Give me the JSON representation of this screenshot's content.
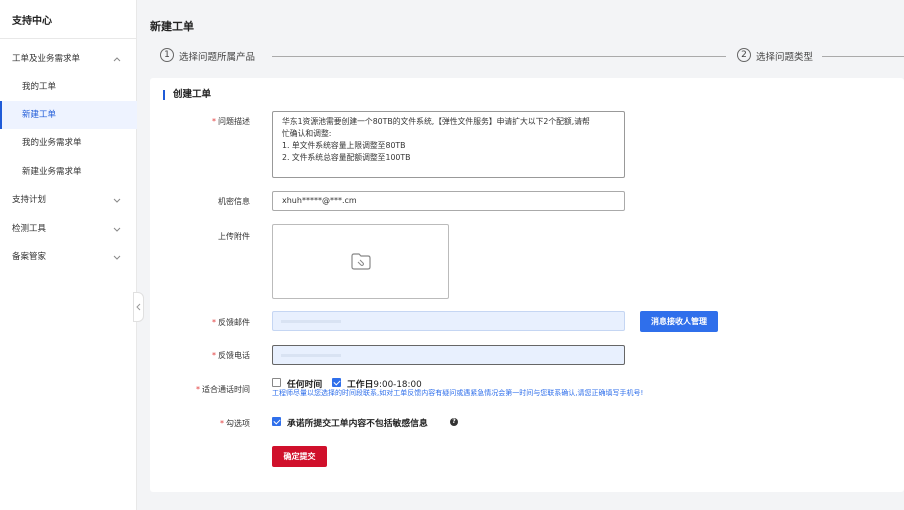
{
  "sidebar": {
    "title": "支持中心",
    "items": [
      {
        "label": "工单及业务需求单",
        "expanded": true
      },
      {
        "label": "我的工单"
      },
      {
        "label": "新建工单",
        "active": true
      },
      {
        "label": "我的业务需求单"
      },
      {
        "label": "新建业务需求单"
      },
      {
        "label": "支持计划"
      },
      {
        "label": "检测工具"
      },
      {
        "label": "备案管家"
      }
    ]
  },
  "header": {
    "title": "新建工单"
  },
  "steps": [
    {
      "num": "1",
      "label": "选择问题所属产品"
    },
    {
      "num": "2",
      "label": "选择问题类型"
    }
  ],
  "form": {
    "section_title": "创建工单",
    "description": {
      "label": "问题描述",
      "lines": [
        "华东1资源池需要创建一个80TB的文件系统,【弹性文件服务】申请扩大以下2个配额,请帮",
        "忙确认和调整:",
        "1. 单文件系统容量上限调整至80TB",
        "2. 文件系统总容量配额调整至100TB"
      ]
    },
    "secret": {
      "label": "机密信息",
      "value": "xhuh*****@***.cm"
    },
    "upload": {
      "label": "上传附件"
    },
    "email": {
      "label": "反馈邮件",
      "value": ""
    },
    "phone": {
      "label": "反馈电话",
      "value": ""
    },
    "manage_button": "消息接收人管理",
    "call_time": {
      "label": "适合通话时间",
      "opt_any": "任何时间",
      "opt_workday": "工作日",
      "workday_hours": "9:00-18:00",
      "hint": "工程师尽量以您选择的时间段联系,如对工单反馈内容有疑问或遇紧急情况会第一时间与您联系确认,请您正确填写手机号!"
    },
    "consent": {
      "label": "勾选项",
      "text": "承诺所提交工单内容不包括敏感信息"
    },
    "submit": "确定提交"
  },
  "colors": {
    "accent": "#2f6feb",
    "submit": "#d0102b",
    "required": "#e23d3d"
  }
}
